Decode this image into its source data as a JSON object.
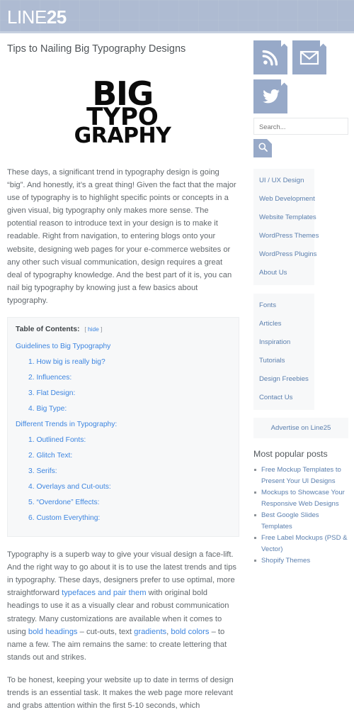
{
  "header": {
    "logo_light": "LINE",
    "logo_bold": "25"
  },
  "article": {
    "title": "Tips to Nailing Big Typography Designs",
    "feature_image": {
      "line1": "BIG",
      "line2": "TYPO",
      "line3": "GRAPHY",
      "alt": "big-typography-artwork"
    },
    "paragraph1": "These days, a significant trend in typography design is going “big”. And honestly, it’s a great thing! Given the fact that the major use of typography is to highlight specific points or concepts in a given visual, big typography only makes more sense. The potential reason to introduce text in your design is to make it readable. Right from navigation, to entering blogs onto your website, designing web pages for your e-commerce websites or any other such visual communication, design requires a great deal of typography knowledge. And the best part of it is, you can nail big typography by knowing just a few basics about typography.",
    "paragraph2_parts": {
      "t1": "Typography is a superb way to give your visual design a face-lift. And the right way to go about it is to use the latest trends and tips in typography. These days, designers prefer to use optimal, more straightforward ",
      "link1": "typefaces and pair them",
      "t2": " with original bold headings to use it as a visually clear and robust communication strategy. Many customizations are available when it comes to using ",
      "link2": "bold headings",
      "t3": " – cut-outs, text ",
      "link3": "gradients",
      "t4": ", ",
      "link4": "bold colors",
      "t5": " – to name a few. The aim remains the same: to create lettering that stands out and strikes."
    },
    "paragraph3": "To be honest, keeping your website up to date in terms of design trends is an essential task. It makes the web page more relevant and grabs attention within the first 5-10 seconds, which"
  },
  "toc": {
    "heading": "Table of Contents:",
    "hide_open": "[",
    "hide_label": "hide",
    "hide_close": "]",
    "sections": [
      {
        "label": "Guidelines to Big Typography",
        "items": [
          "1. How big is really big?",
          "2. Influences:",
          "3. Flat Design:",
          "4. Big Type:"
        ]
      },
      {
        "label": "Different Trends in Typography:",
        "items": [
          "1. Outlined Fonts:",
          "2. Glitch Text:",
          "3. Serifs:",
          "4. Overlays and Cut-outs:",
          "5. “Overdone” Effects:",
          "6. Custom Everything:"
        ]
      }
    ]
  },
  "sidebar": {
    "social": [
      {
        "name": "rss-icon",
        "label": "RSS"
      },
      {
        "name": "envelope-icon",
        "label": "Email"
      },
      {
        "name": "twitter-icon",
        "label": "Twitter"
      }
    ],
    "search": {
      "placeholder": "Search...",
      "value": "",
      "button_icon": "search-icon"
    },
    "menu_primary": [
      "UI / UX Design",
      "Web Development",
      "Website Templates",
      "WordPress Themes",
      "WordPress Plugins",
      "About Us"
    ],
    "menu_secondary": [
      "Fonts",
      "Articles",
      "Inspiration",
      "Tutorials",
      "Design Freebies",
      "Contact Us"
    ],
    "advertise_label": "Advertise on Line25",
    "popular": {
      "title": "Most popular posts",
      "items": [
        "Free Mockup Templates to Present Your UI Designs",
        "Mockups to Showcase Your Responsive Web Designs",
        "Best Google Slides Templates",
        "Free Label Mockups (PSD & Vector)",
        "Shopify Themes"
      ]
    }
  },
  "colors": {
    "header_bg": "#aebbd2",
    "tile_blue": "#97a9c8",
    "link_blue": "#3d85e0",
    "menu_blue": "#5b7fae",
    "panel_bg": "#f7f8f9"
  }
}
